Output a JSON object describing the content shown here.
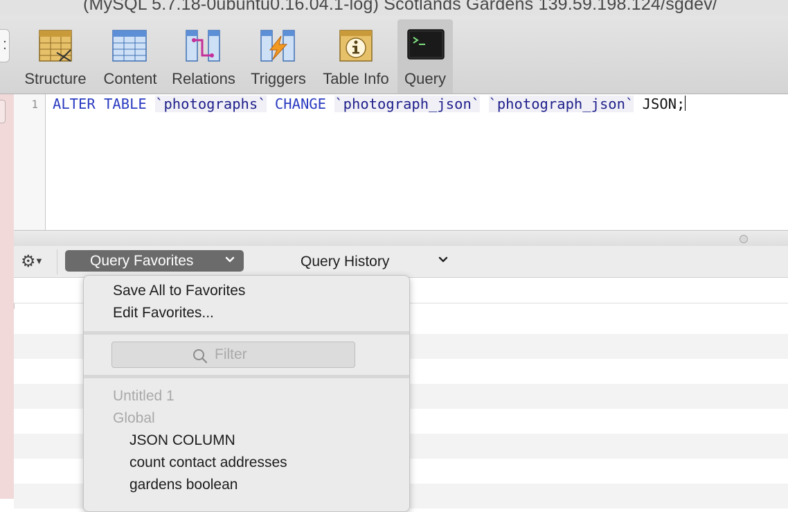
{
  "window": {
    "title": "(MySQL 5.7.18-0ubuntu0.16.04.1-log) Scotlands Gardens 139.59.198.124/sgdev/"
  },
  "toolbar": {
    "back_glyph": ":",
    "items": [
      {
        "label": "Structure",
        "icon": "structure-icon"
      },
      {
        "label": "Content",
        "icon": "content-icon"
      },
      {
        "label": "Relations",
        "icon": "relations-icon"
      },
      {
        "label": "Triggers",
        "icon": "triggers-icon"
      },
      {
        "label": "Table Info",
        "icon": "table-info-icon"
      },
      {
        "label": "Query",
        "icon": "query-icon",
        "selected": true
      }
    ]
  },
  "editor": {
    "line_number": "1",
    "tokens": {
      "alter": "ALTER",
      "table": "TABLE",
      "table_name": "`photographs`",
      "change": "CHANGE",
      "old_col": "`photograph_json`",
      "new_col": "`photograph_json`",
      "type": "JSON;"
    }
  },
  "query_bar": {
    "favorites_label": "Query Favorites",
    "history_label": "Query History"
  },
  "favorites_menu": {
    "save_all": "Save All to Favorites",
    "edit": "Edit Favorites...",
    "filter_placeholder": "Filter",
    "group_untitled": "Untitled 1",
    "group_global": "Global",
    "items": [
      "JSON COLUMN",
      "count contact addresses",
      "gardens boolean"
    ]
  },
  "colors": {
    "keyword": "#2a3bc0",
    "favorites_button": "#6b6b6b",
    "row_stripe": "#f3f3f3"
  }
}
